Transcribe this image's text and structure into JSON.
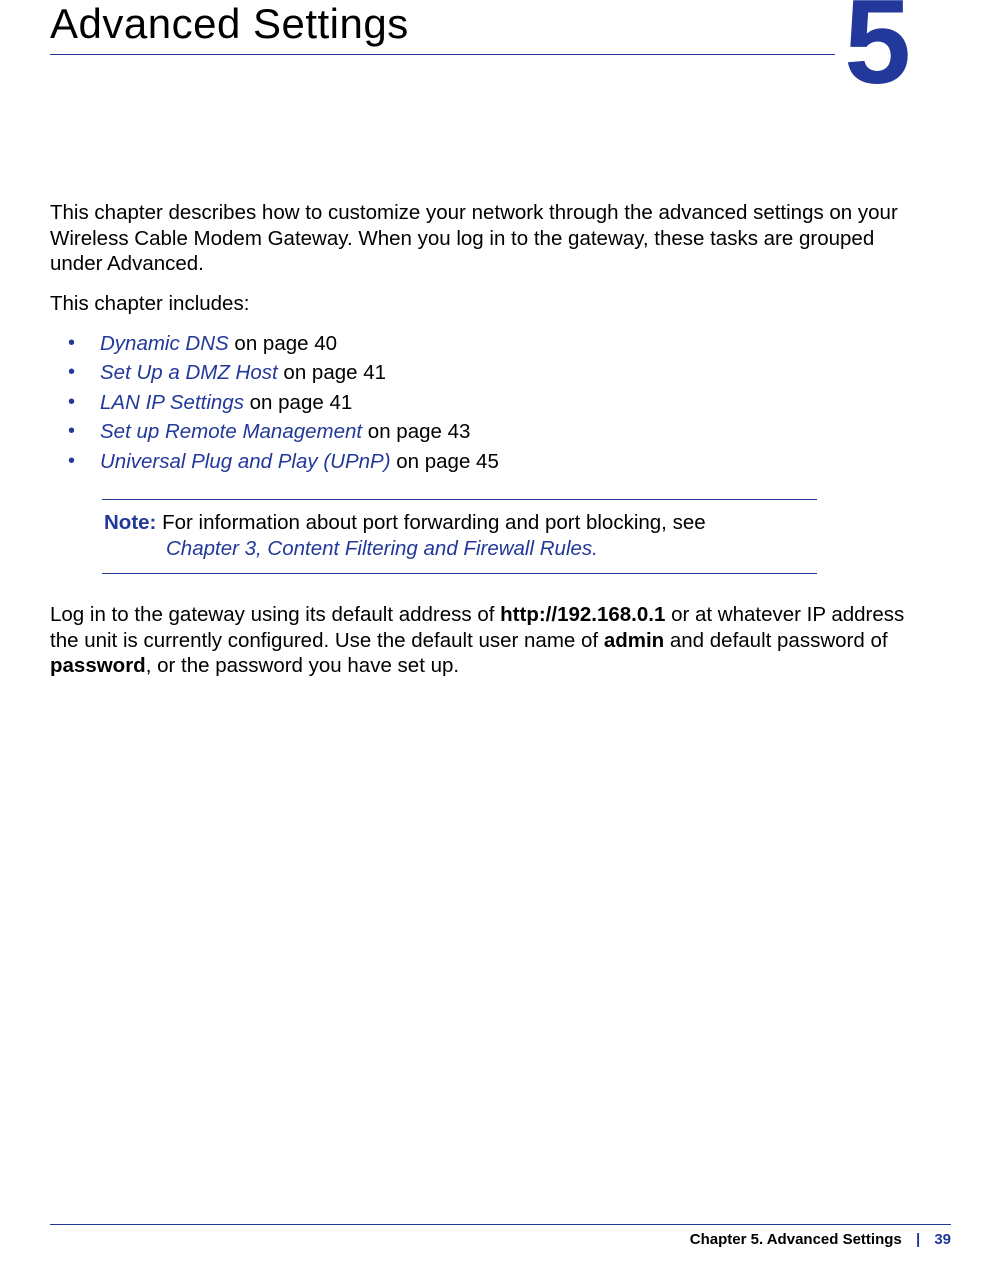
{
  "header": {
    "title": "Advanced Settings",
    "chapter_number": "5"
  },
  "intro": {
    "p1": "This chapter describes how to customize your network through the advanced settings on your Wireless Cable Modem Gateway. When you log in to the gateway, these tasks are grouped under Advanced.",
    "p2": "This chapter includes:"
  },
  "toc": [
    {
      "link": "Dynamic DNS",
      "suffix": " on page 40"
    },
    {
      "link": "Set Up a DMZ Host",
      "suffix": " on page 41"
    },
    {
      "link": "LAN IP Settings",
      "suffix": " on page 41"
    },
    {
      "link": "Set up Remote Management",
      "suffix": " on page 43"
    },
    {
      "link": "Universal Plug and Play (UPnP)",
      "suffix": " on page 45"
    }
  ],
  "note": {
    "label": "Note:  ",
    "text": "For information about port forwarding and port blocking, see ",
    "link": "Chapter 3, Content Filtering and Firewall Rules",
    "after": "."
  },
  "login": {
    "t1": "Log in to the gateway using its default address of ",
    "b1": "http://192.168.0.1",
    "t2": " or at whatever IP address the unit is currently configured. Use the default user name of ",
    "b2": "admin",
    "t3": " and default password of ",
    "b3": "password",
    "t4": ", or the password you have set up."
  },
  "footer": {
    "chapter": "Chapter 5.  Advanced Settings",
    "separator": "|",
    "page": "39"
  }
}
